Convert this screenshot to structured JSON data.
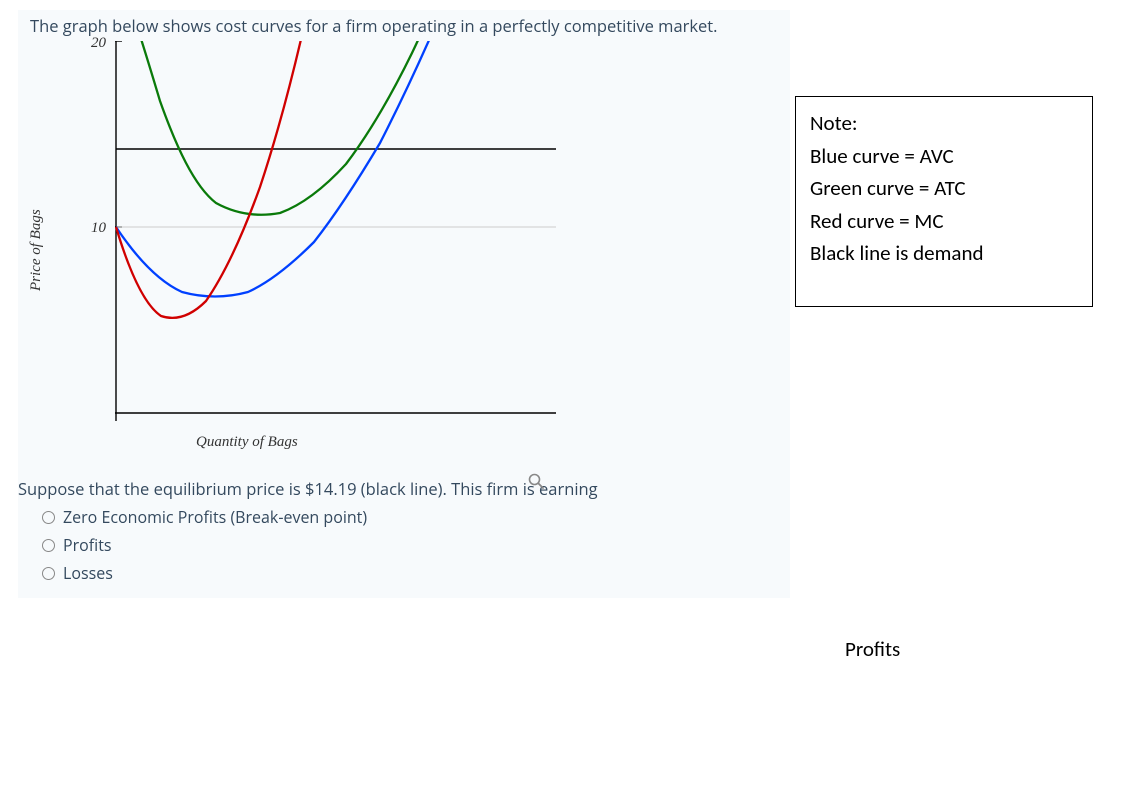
{
  "prompt": "The graph below shows cost curves for a firm operating in a perfectly competitive market.",
  "subprompt": "Suppose that the equilibrium price is $14.19 (black line). This firm is earning",
  "options": [
    "Zero Economic Profits (Break-even point)",
    "Profits",
    "Losses"
  ],
  "note": {
    "heading": "Note:",
    "lines": [
      "Blue curve = AVC",
      "Green curve = ATC",
      "Red curve = MC",
      "Black line is demand"
    ]
  },
  "answer": "Profits",
  "chart_data": {
    "type": "line",
    "title": "",
    "xlabel": "Quantity of Bags",
    "ylabel": "Price of Bags",
    "y_ticks": [
      10,
      20
    ],
    "ylim": [
      0,
      22
    ],
    "series": [
      {
        "name": "AVC",
        "color": "#0040ff",
        "x": [
          0.0,
          0.5,
          1.0,
          1.5,
          2.0,
          2.5,
          3.0,
          3.5,
          4.0,
          4.5,
          5.0,
          5.5,
          6.0,
          6.5,
          7.0,
          7.5
        ],
        "y": [
          10.0,
          8.2,
          7.1,
          6.5,
          6.3,
          6.5,
          7.1,
          8.0,
          9.2,
          10.7,
          12.5,
          14.5,
          16.8,
          19.2,
          21.9,
          25.0
        ]
      },
      {
        "name": "ATC",
        "color": "#0a7a0a",
        "x": [
          0.5,
          1.0,
          1.5,
          2.0,
          2.5,
          3.0,
          3.5,
          4.0,
          4.5,
          5.0,
          5.5,
          6.0,
          6.5,
          7.0,
          7.5
        ],
        "y": [
          28.0,
          18.0,
          13.5,
          11.7,
          10.9,
          10.6,
          10.8,
          11.5,
          12.6,
          14.0,
          15.7,
          17.8,
          20.0,
          22.5,
          25.2
        ]
      },
      {
        "name": "MC",
        "color": "#d00000",
        "x": [
          0.0,
          0.5,
          1.0,
          1.5,
          2.0,
          2.5,
          3.0,
          3.5,
          4.0,
          4.5,
          5.0
        ],
        "y": [
          10.0,
          6.8,
          5.4,
          5.0,
          5.5,
          7.0,
          9.5,
          13.0,
          17.5,
          23.0,
          29.0
        ]
      },
      {
        "name": "Demand",
        "color": "#000000",
        "x": [
          0.0,
          10.0
        ],
        "y": [
          14.19,
          14.19
        ]
      }
    ]
  }
}
